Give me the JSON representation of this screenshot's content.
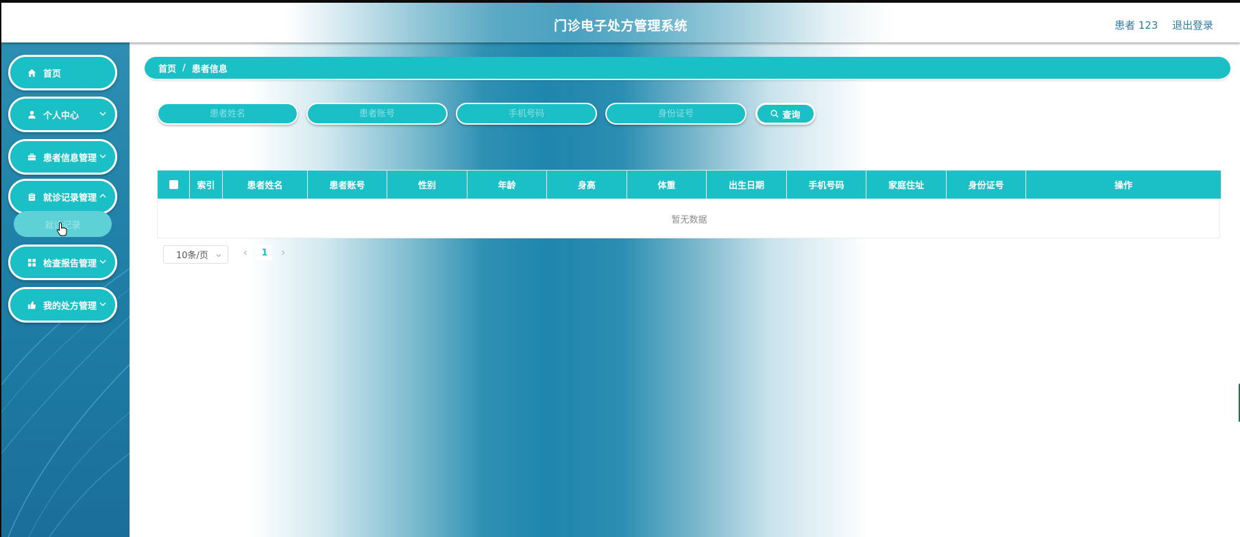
{
  "header": {
    "app_title": "门诊电子处方管理系统",
    "user_name": "患者 123",
    "logout_label": "退出登录"
  },
  "sidebar": {
    "items": [
      {
        "label": "首页",
        "icon": "home-icon"
      },
      {
        "label": "个人中心",
        "icon": "user-icon"
      },
      {
        "label": "患者信息管理",
        "icon": "briefcase-icon"
      },
      {
        "label": "就诊记录管理",
        "icon": "clipboard-icon"
      },
      {
        "label": "检查报告管理",
        "icon": "grid-icon"
      },
      {
        "label": "我的处方管理",
        "icon": "thumbs-up-icon"
      }
    ],
    "submenu": {
      "label": "就诊记录"
    }
  },
  "breadcrumb": {
    "home": "首页",
    "separator": "/",
    "current": "患者信息"
  },
  "search": {
    "name_placeholder": "患者姓名",
    "account_placeholder": "患者账号",
    "phone_placeholder": "手机号码",
    "idcard_placeholder": "身份证号",
    "query_label": "查询"
  },
  "table": {
    "columns": [
      "索引",
      "患者姓名",
      "患者账号",
      "性别",
      "年龄",
      "身高",
      "体重",
      "出生日期",
      "手机号码",
      "家庭住址",
      "身份证号",
      "操作"
    ],
    "rows": [],
    "empty_text": "暂无数据"
  },
  "pagination": {
    "page_size": "10条/页",
    "current_page": "1"
  },
  "colors": {
    "accent": "#1bbfc6",
    "sidebar_bg": "#1f7fa7",
    "header_text": "#2f7ca0"
  }
}
